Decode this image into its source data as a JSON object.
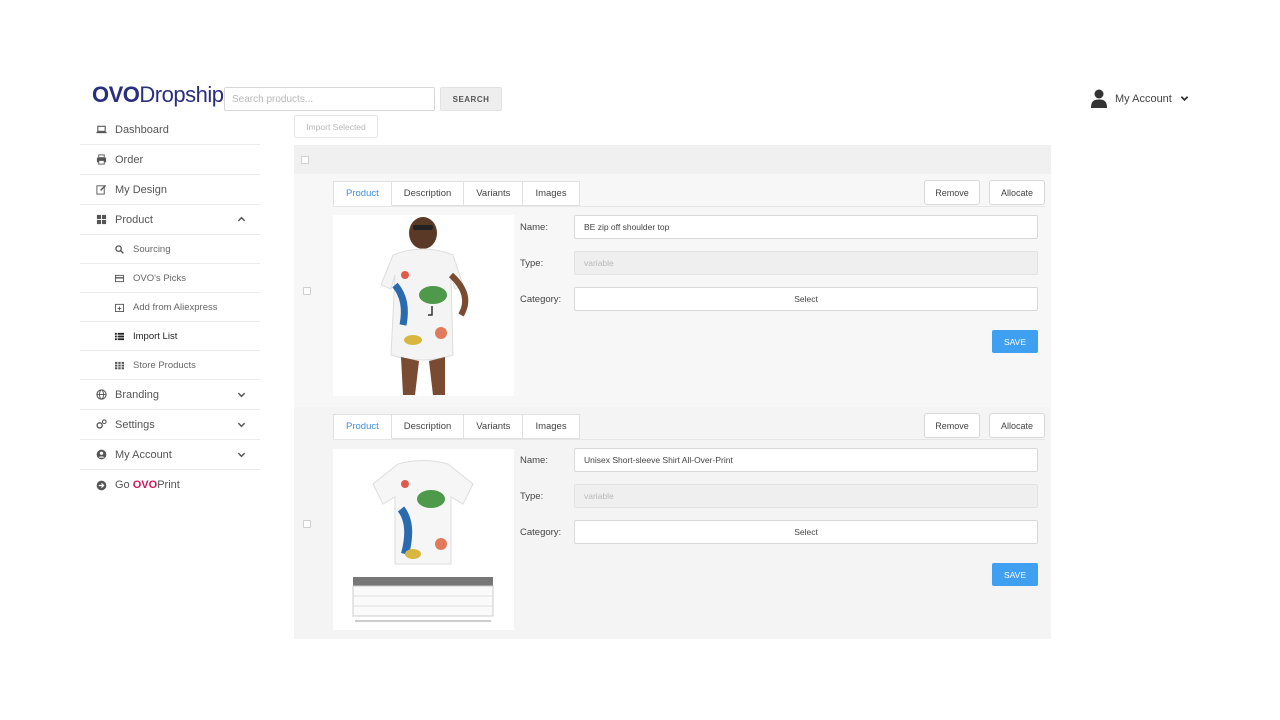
{
  "header": {
    "logo_ovo": "OVO",
    "logo_rest": "Dropship",
    "search_placeholder": "Search products...",
    "search_button": "SEARCH",
    "account_label": "My Account"
  },
  "sidebar": {
    "items": [
      {
        "label": "Dashboard",
        "icon": "laptop-icon"
      },
      {
        "label": "Order",
        "icon": "printer-icon"
      },
      {
        "label": "My Design",
        "icon": "edit-icon"
      },
      {
        "label": "Product",
        "icon": "grid-icon",
        "expanded": true
      },
      {
        "label": "Branding",
        "icon": "globe-icon"
      },
      {
        "label": "Settings",
        "icon": "cogs-icon"
      },
      {
        "label": "My Account",
        "icon": "user-circle-icon"
      }
    ],
    "product_sub": [
      {
        "label": "Sourcing",
        "icon": "search-icon"
      },
      {
        "label": "OVO's Picks",
        "icon": "card-icon"
      },
      {
        "label": "Add from Aliexpress",
        "icon": "calendar-plus-icon"
      },
      {
        "label": "Import List",
        "icon": "list-icon",
        "active": true
      },
      {
        "label": "Store Products",
        "icon": "th-icon"
      }
    ],
    "go_prefix": "Go ",
    "go_ovo": "OVO",
    "go_print": "Print"
  },
  "main": {
    "import_selected": "Import Selected",
    "tabs": [
      "Product",
      "Description",
      "Variants",
      "Images"
    ],
    "remove_label": "Remove",
    "allocate_label": "Allocate",
    "name_label": "Name:",
    "type_label": "Type:",
    "category_label": "Category:",
    "save_label": "SAVE",
    "products": [
      {
        "name": "BE zip off shoulder top",
        "type": "variable",
        "category": "Select"
      },
      {
        "name": "Unisex Short-sleeve Shirt All-Over-Print",
        "type": "variable",
        "category": "Select"
      }
    ]
  },
  "colors": {
    "brand": "#2a2f7d",
    "accent": "#d0175c",
    "tab_active": "#3f8fdb",
    "save_button": "#3fa0f2"
  }
}
